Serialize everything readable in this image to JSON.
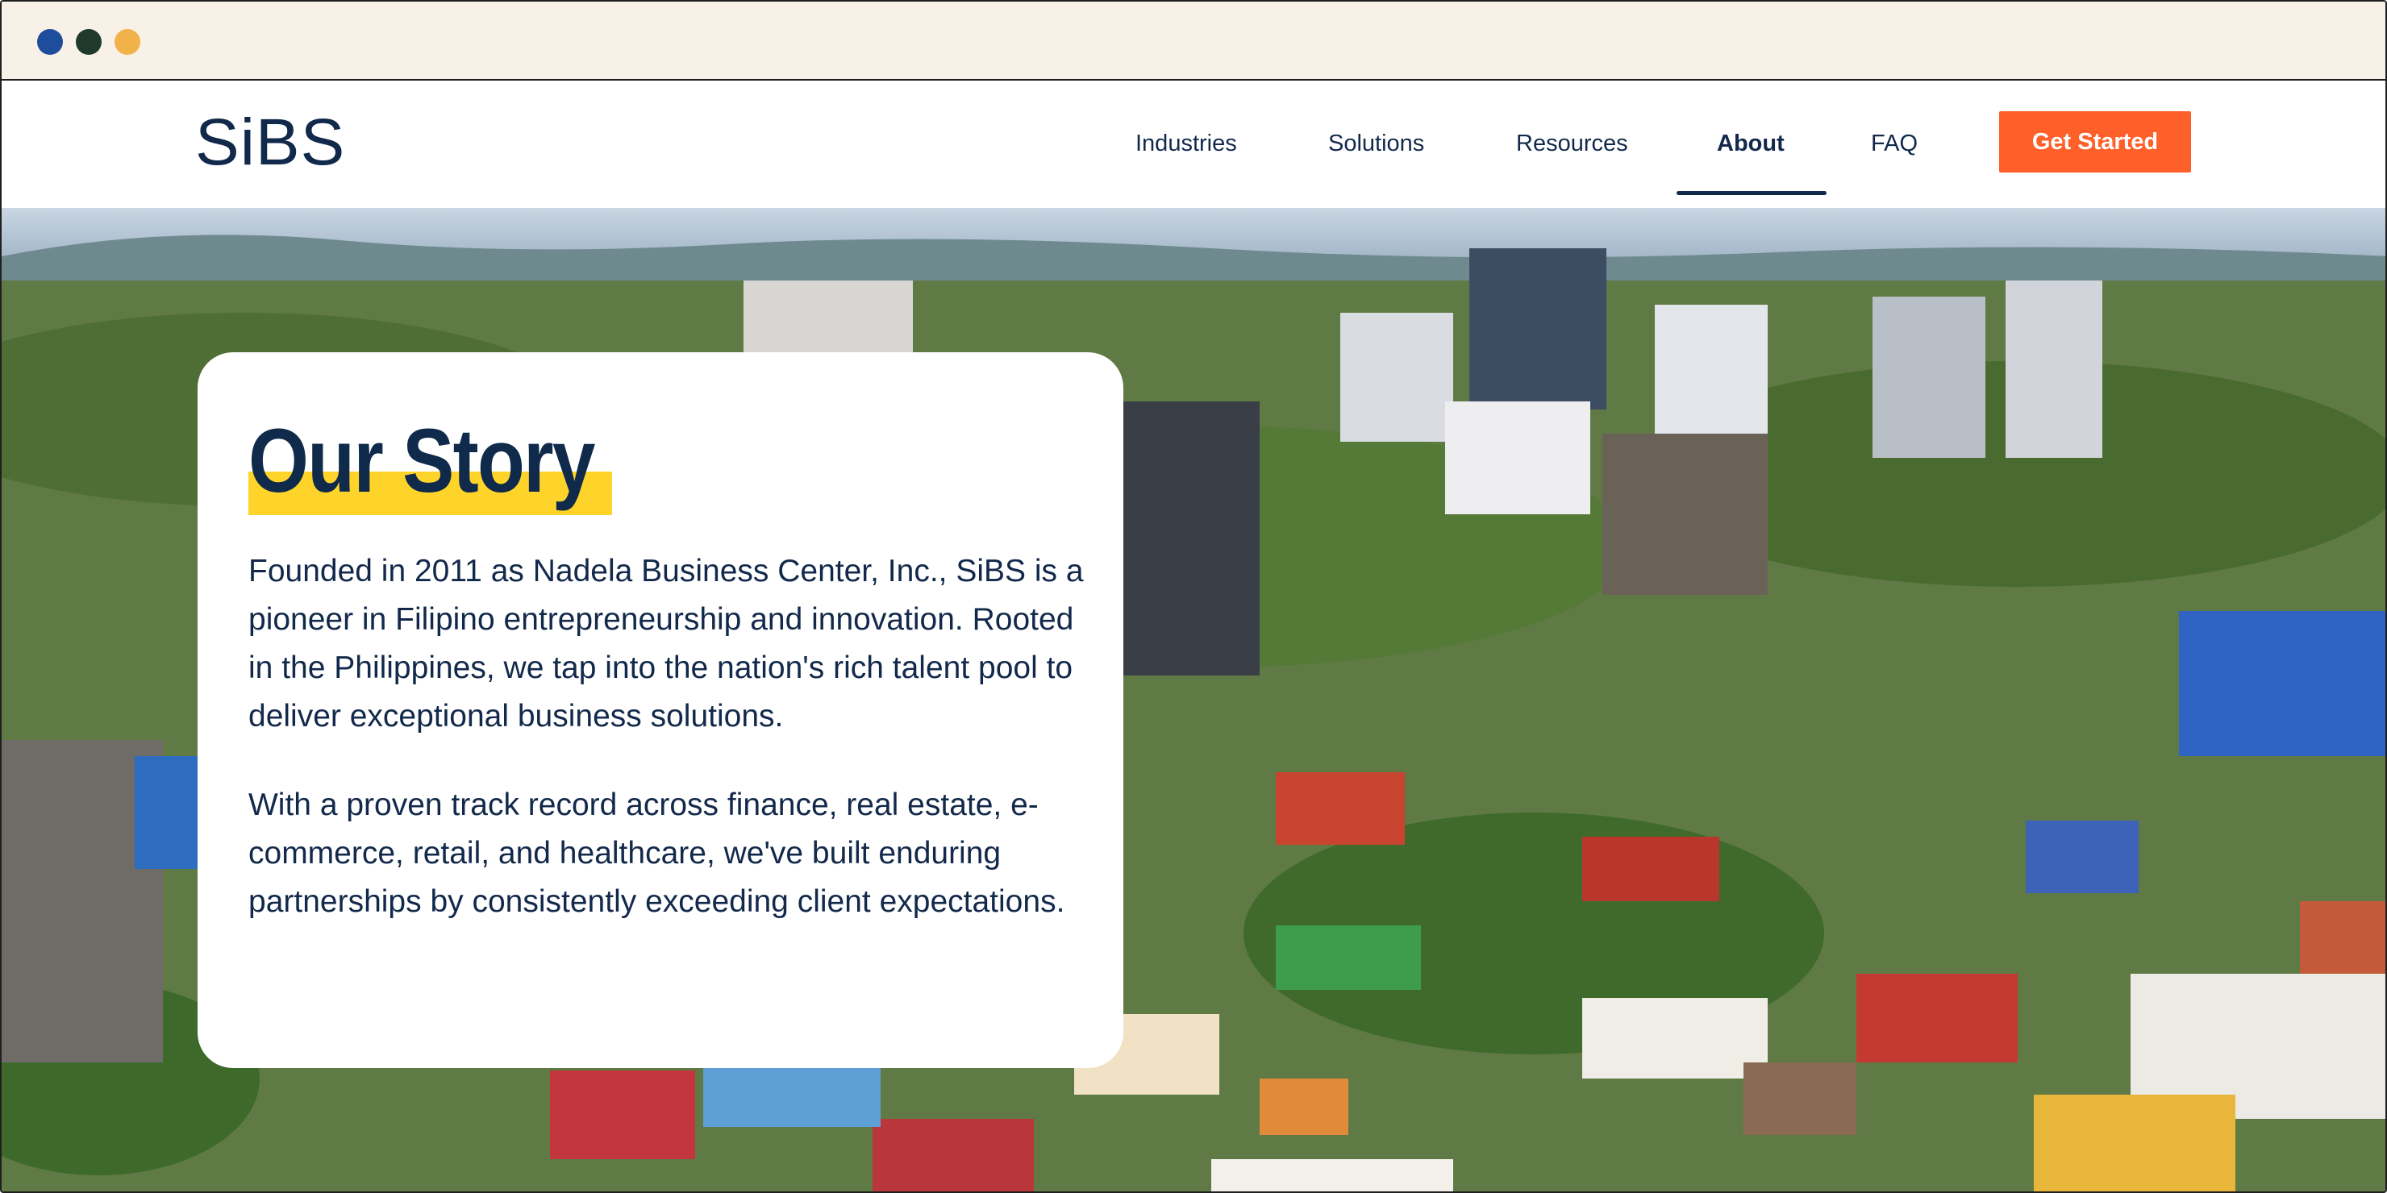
{
  "window": {
    "controls": [
      "close",
      "minimize",
      "maximize"
    ]
  },
  "header": {
    "logo_text": "SiBS",
    "nav": [
      {
        "label": "Industries"
      },
      {
        "label": "Solutions"
      },
      {
        "label": "Resources"
      },
      {
        "label": "About",
        "active": true
      },
      {
        "label": "FAQ"
      }
    ],
    "cta_label": "Get Started"
  },
  "hero": {
    "image_alt": "Aerial city view with rooftops, towers and greenery"
  },
  "story": {
    "title": "Our Story",
    "paragraphs": [
      "Founded in 2011 as Nadela Business Center, Inc., SiBS is a pioneer in Filipino entrepreneurship and innovation. Rooted in the Philippines, we tap into the nation's rich talent pool to deliver exceptional business solutions.",
      "With a proven track record across finance, real estate, e-commerce, retail, and healthcare, we've built enduring partnerships by consistently exceeding client expectations."
    ]
  },
  "colors": {
    "brand_navy": "#13294b",
    "cta_orange": "#ff5f28",
    "title_highlight": "#ffd42a",
    "chrome_bg": "#f7f1e8"
  }
}
